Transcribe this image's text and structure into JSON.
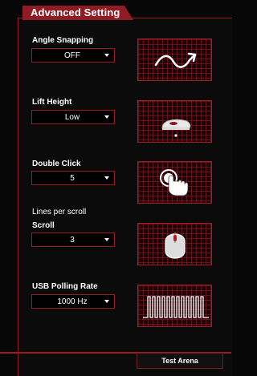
{
  "panel": {
    "title": "Advanced Setting"
  },
  "angle_snapping": {
    "label": "Angle Snapping",
    "value": "OFF",
    "preview_icon": "wave-arrow-icon"
  },
  "lift_height": {
    "label": "Lift Height",
    "value": "Low",
    "preview_icon": "mouse-side-icon"
  },
  "double_click": {
    "label": "Double Click",
    "value": "5",
    "preview_icon": "hand-click-icon"
  },
  "scroll": {
    "caption": "Lines per scroll",
    "label": "Scroll",
    "value": "3",
    "preview_icon": "mouse-top-icon"
  },
  "usb_polling": {
    "label": "USB Polling Rate",
    "value": "1000 Hz",
    "preview_icon": "square-wave-icon"
  },
  "footer": {
    "test_button": "Test Arena"
  },
  "colors": {
    "accent": "#9b1b22",
    "background": "#070707",
    "text": "#ffffff"
  }
}
